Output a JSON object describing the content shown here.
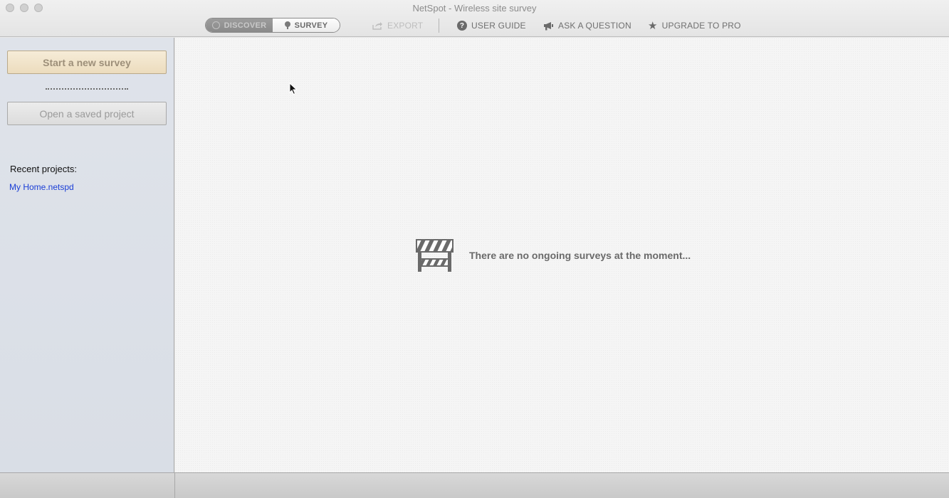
{
  "window": {
    "title": "NetSpot - Wireless site survey"
  },
  "toolbar": {
    "mode_discover": "DISCOVER",
    "mode_survey": "SURVEY",
    "export": "EXPORT",
    "user_guide": "USER GUIDE",
    "ask_question": "ASK A QUESTION",
    "upgrade": "UPGRADE TO PRO"
  },
  "sidebar": {
    "start_button": "Start a new survey",
    "open_button": "Open a saved project",
    "recent_label": "Recent projects:",
    "recent_projects": [
      "My Home.netspd"
    ]
  },
  "main": {
    "empty_message": "There are no ongoing surveys at the moment..."
  },
  "colors": {
    "link": "#1a3ed6",
    "sidebar_bg": "#dfe3ea",
    "start_button_bg": "#f6ecd8"
  }
}
